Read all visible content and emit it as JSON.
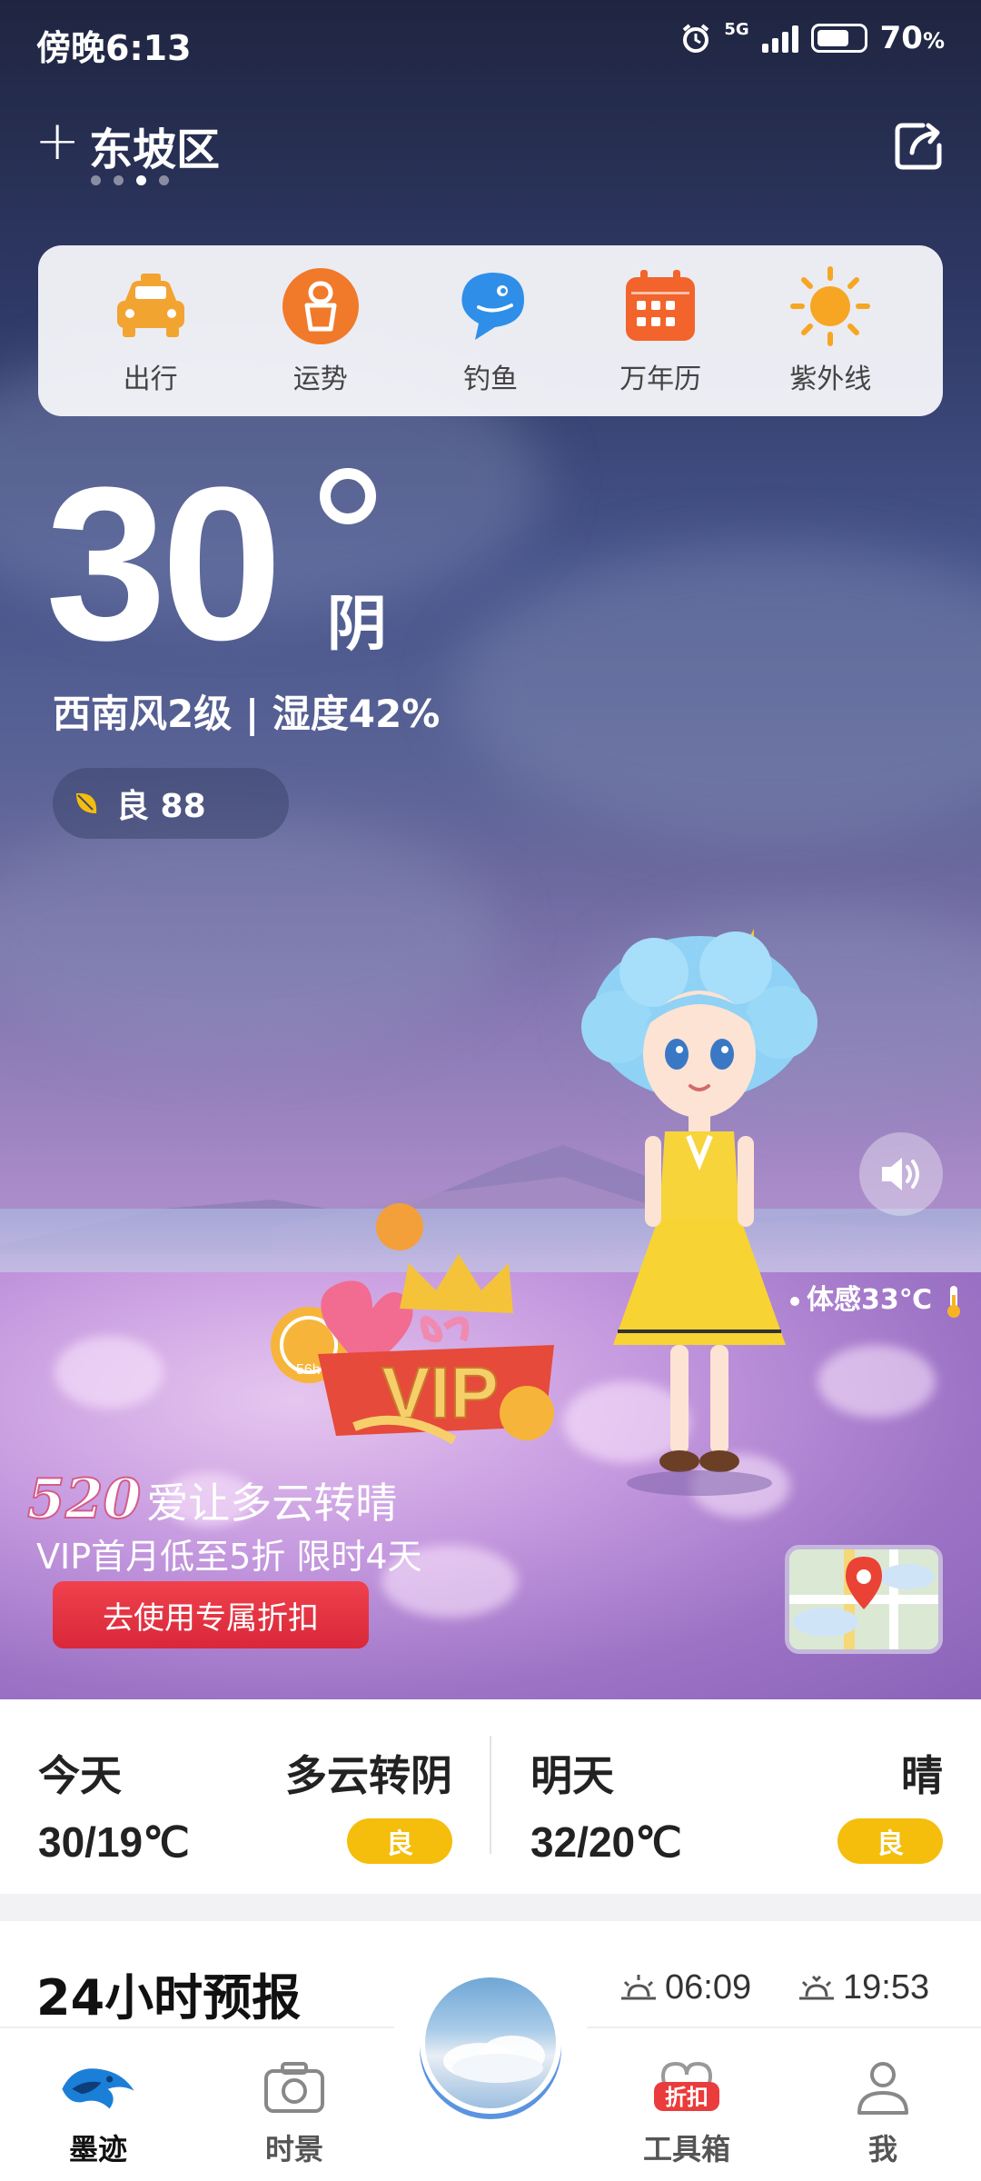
{
  "status_bar": {
    "time": "傍晚6:13",
    "network": "5G",
    "battery": "70",
    "battery_unit": "%"
  },
  "header": {
    "city": "东坡区",
    "page_count": 4,
    "active_page": 2
  },
  "tools": [
    {
      "label": "出行",
      "icon": "taxi-icon"
    },
    {
      "label": "运势",
      "icon": "fortune-icon"
    },
    {
      "label": "钓鱼",
      "icon": "fish-icon"
    },
    {
      "label": "万年历",
      "icon": "calendar-icon"
    },
    {
      "label": "紫外线",
      "icon": "sun-icon"
    }
  ],
  "current": {
    "temperature": "30",
    "condition": "阴",
    "wind_humidity": "西南风2级 | 湿度42%",
    "aqi": "良 88",
    "feels_like": "体感33℃"
  },
  "promo": {
    "number": "520",
    "title": "爱让多云转晴",
    "subtitle": "VIP首月低至5折 限时4天",
    "button": "去使用专属折扣",
    "vip_text": "VIP",
    "badge_hours": "56h"
  },
  "days": [
    {
      "name": "今天",
      "weather": "多云转阴",
      "range": "30/19℃",
      "aqi": "良"
    },
    {
      "name": "明天",
      "weather": "晴",
      "range": "32/20℃",
      "aqi": "良"
    }
  ],
  "hourly": {
    "title": "24小时预报",
    "sunrise": "06:09",
    "sunset": "19:53"
  },
  "tabbar": [
    {
      "label": "墨迹",
      "icon": "moji-logo-icon",
      "active": true
    },
    {
      "label": "时景",
      "icon": "camera-icon",
      "active": false
    },
    {
      "label": "工具箱",
      "icon": "toolbox-icon",
      "active": false,
      "badge": "折扣"
    },
    {
      "label": "我",
      "icon": "profile-icon",
      "active": false
    }
  ],
  "colors": {
    "aqi_good": "#f5bd0c",
    "promo_button": "#e0303f",
    "tool_orange": "#f07a2a",
    "tool_blue": "#2f8fe8"
  }
}
